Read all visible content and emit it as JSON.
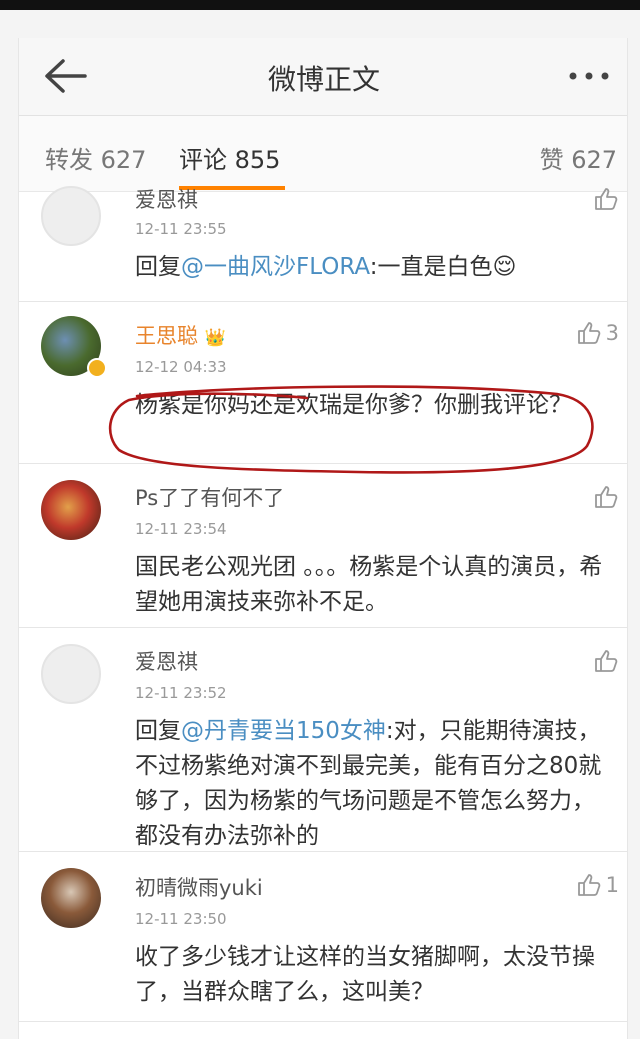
{
  "header": {
    "title": "微博正文",
    "back_icon": "back-arrow-icon",
    "more_icon": "more-dots-icon"
  },
  "tabs": {
    "repost": "转发 627",
    "comments": "评论 855",
    "likes": "赞 627",
    "accent": "#ff8200"
  },
  "comments": [
    {
      "user": "爱恩祺",
      "time": "12-11 23:55",
      "reply_prefix": "回复",
      "mention": "@一曲风沙FLORA",
      "text": ":一直是白色",
      "emoji": "😌",
      "likes": ""
    },
    {
      "user": "王思聪",
      "badge": "👑",
      "time": "12-12 04:33",
      "text": "杨紫是你妈还是欢瑞是你爹？你删我评论？",
      "likes": "3"
    },
    {
      "user": "Ps了了有何不了",
      "time": "12-11 23:54",
      "text": "国民老公观光团 。。。杨紫是个认真的演员，希望她用演技来弥补不足。",
      "likes": ""
    },
    {
      "user": "爱恩祺",
      "time": "12-11 23:52",
      "reply_prefix": "回复",
      "mention": "@丹青要当150女神",
      "text": ":对，只能期待演技，不过杨紫绝对演不到最完美，能有百分之80就够了，因为杨紫的气场问题是不管怎么努力，都没有办法弥补的",
      "likes": ""
    },
    {
      "user": "初晴微雨yuki",
      "time": "12-11 23:50",
      "text": "收了多少钱才让这样的当女猪脚啊，太没节操了，当群众瞎了么，这叫美？",
      "likes": "1"
    }
  ],
  "colors": {
    "mention": "#4a8ec2",
    "vip_name": "#e8842c",
    "annotation": "#b01818"
  }
}
